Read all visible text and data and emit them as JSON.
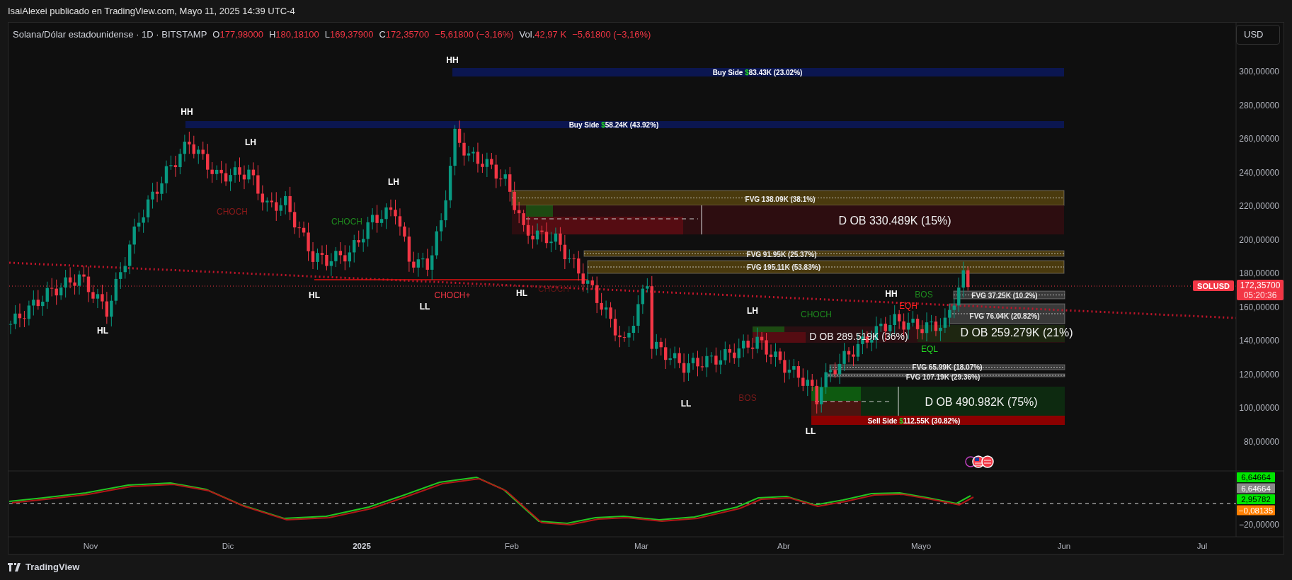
{
  "header": {
    "text": "IsaiAlexei publicado en TradingView.com, Mayo 11, 2025 14:39 UTC-4"
  },
  "legend": {
    "symbol": "Solana/Dólar estadounidense · 1D · BITSTAMP",
    "ohlc": [
      {
        "label": "O",
        "value": "177,98000"
      },
      {
        "label": "H",
        "value": "180,18100"
      },
      {
        "label": "L",
        "value": "169,37900"
      },
      {
        "label": "C",
        "value": "172,35700"
      }
    ],
    "change": "−5,61800 (−3,16%)",
    "volume": {
      "label": "Vol.",
      "value": "42,97 K",
      "change": "−5,61800 (−3,16%)"
    }
  },
  "currency_button": "USD",
  "zones": [
    {
      "kind": "buy_side",
      "label": "Buy Side",
      "currency": "$",
      "amount": "83.43K (23.02%)",
      "color": "#0b1650"
    },
    {
      "kind": "buy_side",
      "label": "Buy Side",
      "currency": "$",
      "amount": "58.24K (43.92%)",
      "color": "#0b1650"
    },
    {
      "kind": "fvg",
      "label": "FVG 138.09K (38.1%)",
      "color": "#4a3a0e"
    },
    {
      "kind": "order_block",
      "label": "D OB 330.489K (15%)",
      "color": "#2d0d10"
    },
    {
      "kind": "fvg",
      "label": "FVG 91.95K (25.37%)",
      "color": "#4a3a0e"
    },
    {
      "kind": "fvg",
      "label": "FVG 195.11K (53.83%)",
      "color": "#4a3a0e"
    },
    {
      "kind": "fvg",
      "label": "FVG 37.25K (10.2%)",
      "color": "#3a3a3a"
    },
    {
      "kind": "fvg",
      "label": "FVG 76.04K (20.82%)",
      "color": "#3a3a3a"
    },
    {
      "kind": "order_block",
      "label": "D OB 289.519K (36%)",
      "color": "#2a0f12"
    },
    {
      "kind": "order_block",
      "label": "D OB 259.279K (21%)",
      "color": "#1c2a12"
    },
    {
      "kind": "fvg",
      "label": "FVG 65.99K (18.07%)",
      "color": "#3a3a3a"
    },
    {
      "kind": "fvg",
      "label": "FVG 107.19K (29.36%)",
      "color": "#3a3a3a"
    },
    {
      "kind": "order_block",
      "label": "D OB 490.982K (75%)",
      "color": "#0d2a10"
    },
    {
      "kind": "sell_side",
      "label": "Sell Side",
      "currency": "$",
      "amount": "112.55K (30.82%)",
      "color": "#8b0000"
    }
  ],
  "structure_labels": [
    {
      "text": "HH",
      "color": "#ffffff"
    },
    {
      "text": "HH",
      "color": "#ffffff"
    },
    {
      "text": "LH",
      "color": "#ffffff"
    },
    {
      "text": "LH",
      "color": "#ffffff"
    },
    {
      "text": "HL",
      "color": "#ffffff"
    },
    {
      "text": "HL",
      "color": "#ffffff"
    },
    {
      "text": "LL",
      "color": "#ffffff"
    },
    {
      "text": "CHOCH+",
      "color": "#f23645"
    },
    {
      "text": "HL",
      "color": "#ffffff"
    },
    {
      "text": "CHOCH",
      "color": "#8b1a1a"
    },
    {
      "text": "CHOCH",
      "color": "#1e8a1e"
    },
    {
      "text": "CHOCH",
      "color": "#5a1515"
    },
    {
      "text": "LH",
      "color": "#ffffff"
    },
    {
      "text": "CHOCH",
      "color": "#1e8a1e"
    },
    {
      "text": "LL",
      "color": "#ffffff"
    },
    {
      "text": "BOS",
      "color": "#7a1a1a"
    },
    {
      "text": "LL",
      "color": "#ffffff"
    },
    {
      "text": "HH",
      "color": "#ffffff"
    },
    {
      "text": "EQH",
      "color": "#ff2020"
    },
    {
      "text": "BOS",
      "color": "#1e8a1e"
    },
    {
      "text": "EQL",
      "color": "#22dd22"
    }
  ],
  "price_axis": [
    "300,00000",
    "280,00000",
    "260,00000",
    "240,00000",
    "220,00000",
    "200,00000",
    "180,00000",
    "160,00000",
    "140,00000",
    "120,00000",
    "100,00000",
    "80,00000"
  ],
  "last_price": {
    "symbol": "SOLUSD",
    "price": "172,35700",
    "countdown": "05:20:36"
  },
  "oscillator_axis": [
    {
      "value": "6,64664",
      "color": "#00e600"
    },
    {
      "value": "6,64664",
      "color": "#888888"
    },
    {
      "value": "2,95782",
      "color": "#00e600"
    },
    {
      "value": "−0,08135",
      "color": "#ff7f00"
    }
  ],
  "oscillator_scale": "−20,00000",
  "time_axis": [
    {
      "label": "Nov",
      "major": false
    },
    {
      "label": "Dic",
      "major": false
    },
    {
      "label": "2025",
      "major": true
    },
    {
      "label": "Feb",
      "major": false
    },
    {
      "label": "Mar",
      "major": false
    },
    {
      "label": "Abr",
      "major": false
    },
    {
      "label": "Mayo",
      "major": false
    },
    {
      "label": "Jun",
      "major": false
    },
    {
      "label": "Jul",
      "major": false
    }
  ],
  "footer": {
    "brand": "TradingView"
  }
}
